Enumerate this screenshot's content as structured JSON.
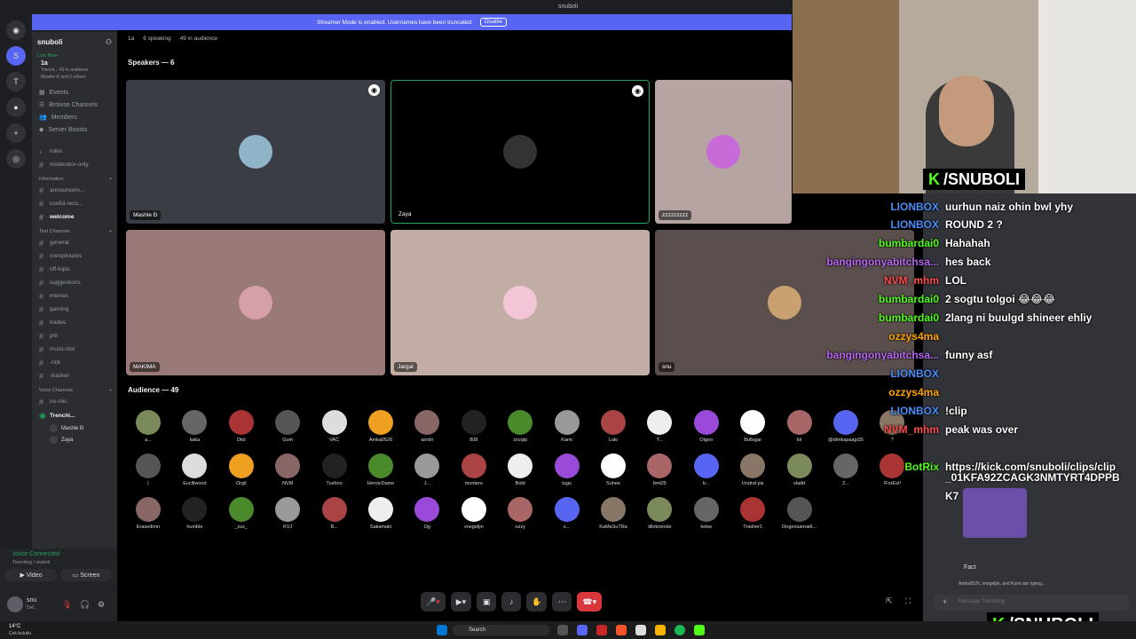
{
  "window_title": "snuboli",
  "banner": {
    "text": "Streamer Mode is enabled. Usernames have been truncated.",
    "button": "Disable"
  },
  "server": {
    "name": "snuboli",
    "live": "Live Now",
    "stage": "1a",
    "meta1": "Trench...  49 in audience",
    "meta2": "Mashle Đ and 6 others"
  },
  "menu": [
    "Events",
    "Browse Channels",
    "Members",
    "Server Boosts"
  ],
  "channels_top": [
    "rules",
    "moderator-only"
  ],
  "cat_info": "Information",
  "info_channels": [
    "announcem...",
    "useful-reco...",
    "welcome"
  ],
  "cat_text": "Text Channels",
  "text_channels": [
    "general",
    "conspiracies",
    "off-topic",
    "suggestions",
    "memes",
    "gaming",
    "trades",
    "pnl",
    "music-bot",
    "-rick",
    "-tracker"
  ],
  "cat_voice": "Voice Channels",
  "voice_channels": [
    "no-mic",
    "Trenchi..."
  ],
  "voice_users": [
    "Mashle Đ",
    "Zaya"
  ],
  "voicebar": {
    "status": "Voice Connected",
    "sub": "Trenching / snuboli",
    "video": "Video",
    "screen": "Screen"
  },
  "userbar": {
    "name": "snu",
    "status": "Def..."
  },
  "header": {
    "stage": "1a",
    "speaking": "6 speaking",
    "audience": "49 in audience"
  },
  "speakers_label": "Speakers — 6",
  "speakers": [
    "Mashle Đ",
    "Zaya",
    "zzzzzzzzz",
    "MAKIMA",
    "Jargal",
    "snu"
  ],
  "audience_label": "Audience — 49",
  "audience": [
    [
      "a...",
      "kaka",
      "Diid",
      "Gum",
      "VAC",
      "Amka0526",
      "anrdn",
      "808",
      "zxcqtp",
      "Karin",
      "Lalo",
      "T...",
      "Otgoo",
      "Bullsgar",
      "lol",
      "@dimkapaagi35",
      "?"
    ],
    [
      "|",
      "Euclilwood",
      "Orgil",
      "NVM",
      "Tushno",
      "HeroicDame",
      "J...",
      "montero",
      "Bold",
      "tugu",
      "Suhee",
      "bml25",
      "b...",
      "Undral pis",
      "vladd",
      "2...",
      "!ForEst!"
    ],
    [
      "Erasedimn",
      "humble",
      "_zzz_",
      "KVJ",
      "B...",
      "Sakamaki",
      "Og",
      "vnegeljin",
      "ozzy",
      "x...",
      "KaMaSuTRa",
      "tilloknende",
      "kekw",
      "Trasher1",
      "Ongonsarnai6..."
    ]
  ],
  "kick": "/SNUBOLI",
  "chat_overlay": [
    [
      "LIONBOX",
      "uurhun naiz ohin bwl yhy",
      "#4b8df8"
    ],
    [
      "LIONBOX",
      "ROUND 2 ?",
      "#4b8df8"
    ],
    [
      "bumbardai0",
      "Hahahah",
      "#53fc18"
    ],
    [
      "bangingonyabitchsa...",
      "hes back",
      "#b667f1"
    ],
    [
      "NVM_mhm",
      "LOL",
      "#ff4d4d"
    ],
    [
      "bumbardai0",
      "2 sogtu tolgoi 😂😂😂",
      "#53fc18"
    ],
    [
      "bumbardai0",
      "2lang ni buulgd shineer ehliy",
      "#53fc18"
    ],
    [
      "ozzys4ma",
      "",
      "#ffa500"
    ],
    [
      "bangingonyabitchsa...",
      "funny asf",
      "#b667f1"
    ],
    [
      "LIONBOX",
      "",
      "#4b8df8"
    ],
    [
      "ozzys4ma",
      "",
      "#ffa500"
    ],
    [
      "LIONBOX",
      "!clip",
      "#4b8df8"
    ],
    [
      "NVM_mhm",
      "peak was over",
      "#ff4d4d"
    ],
    [
      "BotRix",
      "https://kick.com/snuboli/clips/clip",
      "#53fc18"
    ]
  ],
  "clip_line2": "_01KFA92ZCAGK3NMTYRT4DPPB",
  "clip_line3": "K7",
  "chat_msgs": [
    "Fact",
    "Amka0526, vnegeljin, and Karin are typing..."
  ],
  "chat_input": "Message Trenching",
  "taskbar": {
    "weather": "14°C",
    "weather2": "Çok bulutlu",
    "search": "Search"
  }
}
